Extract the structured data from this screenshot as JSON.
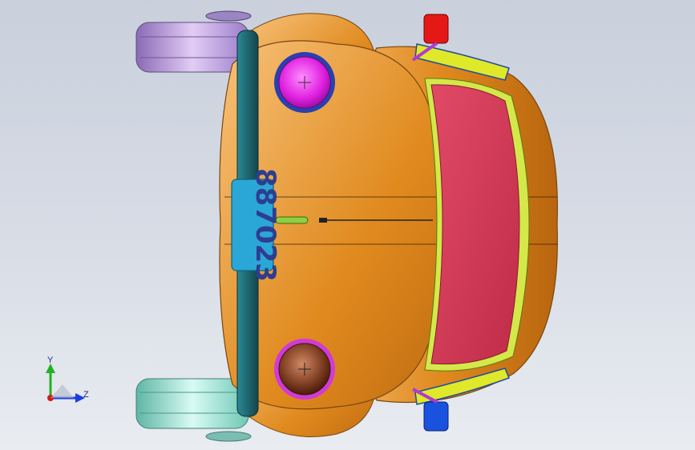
{
  "viewport": {
    "background_top": "#c9d0dc",
    "background_bottom": "#e9ecf1"
  },
  "model": {
    "name_icon": "vw-beetle-model",
    "license_plate": {
      "text": "887023",
      "plate_color": "#2aa7d6",
      "text_color": "#2e3d8f"
    },
    "colors": {
      "body": "#e08a1e",
      "windshield": "#d23a55",
      "left_headlight": "#e020e0",
      "right_headlight": "#7a3a1e",
      "bumper": "#1f6670",
      "wheel_top": "#b48ee0",
      "wheel_bottom": "#8ee0cf",
      "mirror_top": "#e51818",
      "mirror_bottom": "#1a52e0"
    }
  },
  "triad": {
    "y_label": "Y",
    "z_label": "Z",
    "y_color": "#22b122",
    "z_color": "#1c3ee0",
    "x_color": "#d21b1b"
  }
}
